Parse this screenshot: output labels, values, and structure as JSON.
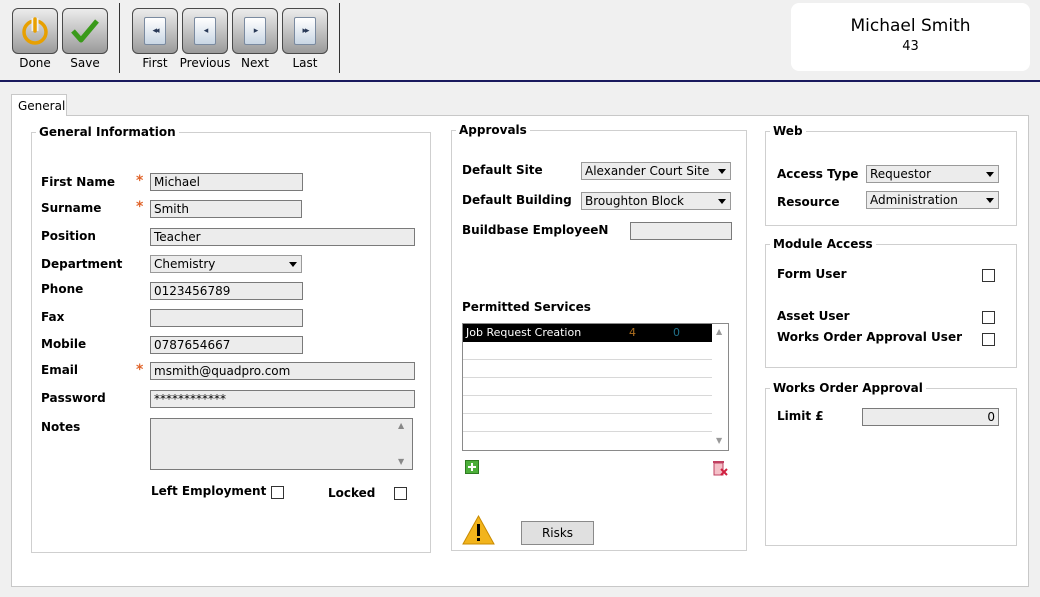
{
  "toolbar": {
    "done_label": "Done",
    "save_label": "Save",
    "first_label": "First",
    "previous_label": "Previous",
    "next_label": "Next",
    "last_label": "Last"
  },
  "user": {
    "name": "Michael Smith",
    "id": "43"
  },
  "tabs": {
    "general": "General"
  },
  "general_info": {
    "title": "General Information",
    "first_name_label": "First Name",
    "first_name": "Michael",
    "surname_label": "Surname",
    "surname": "Smith",
    "position_label": "Position",
    "position": "Teacher",
    "department_label": "Department",
    "department": "Chemistry",
    "phone_label": "Phone",
    "phone": "0123456789",
    "fax_label": "Fax",
    "fax": "",
    "mobile_label": "Mobile",
    "mobile": "0787654667",
    "email_label": "Email",
    "email": "msmith@quadpro.com",
    "password_label": "Password",
    "password": "************",
    "notes_label": "Notes",
    "notes": "",
    "left_employment_label": "Left Employment",
    "locked_label": "Locked",
    "required_mark": "*"
  },
  "approvals": {
    "title": "Approvals",
    "default_site_label": "Default Site",
    "default_site": "Alexander Court Site",
    "default_building_label": "Default Building",
    "default_building": "Broughton Block",
    "employee_label": "Buildbase EmployeeN",
    "employee": "",
    "permitted_label": "Permitted Services",
    "services": [
      {
        "name": "Job Request Creation",
        "c1": "4",
        "c2": "0"
      }
    ],
    "risks_label": "Risks"
  },
  "web": {
    "title": "Web",
    "access_type_label": "Access Type",
    "access_type": "Requestor",
    "resource_label": "Resource",
    "resource": "Administration"
  },
  "module_access": {
    "title": "Module Access",
    "form_user_label": "Form User",
    "asset_user_label": "Asset User",
    "works_order_label": "Works Order Approval User"
  },
  "works_order_approval": {
    "title": "Works Order Approval",
    "limit_label": "Limit £",
    "limit": "0"
  },
  "colors": {
    "accent_line": "#1a1a5e",
    "required": "#e0642a",
    "done_icon": "#e8a000",
    "save_icon": "#3a9a1a"
  }
}
